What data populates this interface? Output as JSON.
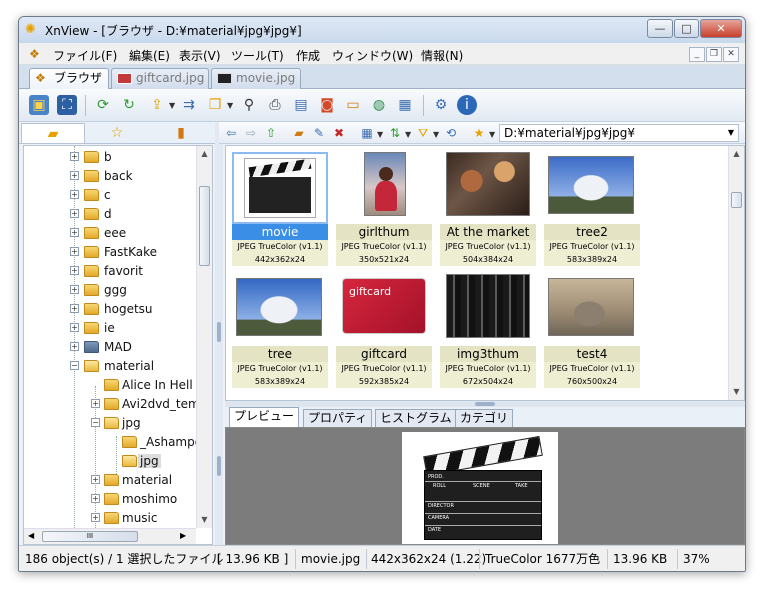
{
  "window": {
    "title": "XnView - [ブラウザ - D:¥material¥jpg¥jpg¥]",
    "controls": {
      "minimize": "—",
      "maximize": "□",
      "close": "✕"
    }
  },
  "menu": {
    "items": [
      "ファイル(F)",
      "編集(E)",
      "表示(V)",
      "ツール(T)",
      "作成",
      "ウィンドウ(W)",
      "情報(N)"
    ],
    "mdi": {
      "minimize": "_",
      "restore": "❐",
      "close": "✕"
    }
  },
  "tabs": [
    {
      "label": "ブラウザ",
      "active": true
    },
    {
      "label": "giftcard.jpg",
      "active": false
    },
    {
      "label": "movie.jpg",
      "active": false
    }
  ],
  "toolbar_icons": [
    "open-icon",
    "fullscreen-icon",
    "refresh-icon",
    "rotate-icon",
    "export-icon",
    "print-icon",
    "convert-icon",
    "find-icon",
    "printer-icon",
    "slideshow-icon",
    "camera-icon",
    "screen-icon",
    "web-icon",
    "info-icon",
    "settings-icon",
    "about-icon"
  ],
  "left_tabs": [
    "folders",
    "favorites",
    "categories"
  ],
  "tree": {
    "items": [
      {
        "label": "b",
        "level": 2,
        "expander": "+"
      },
      {
        "label": "back",
        "level": 2,
        "expander": "+"
      },
      {
        "label": "c",
        "level": 2,
        "expander": "+"
      },
      {
        "label": "d",
        "level": 2,
        "expander": "+"
      },
      {
        "label": "eee",
        "level": 2,
        "expander": "+"
      },
      {
        "label": "FastKake",
        "level": 2,
        "expander": "+"
      },
      {
        "label": "favorit",
        "level": 2,
        "expander": "+"
      },
      {
        "label": "ggg",
        "level": 2,
        "expander": "+"
      },
      {
        "label": "hogetsu",
        "level": 2,
        "expander": "+"
      },
      {
        "label": "ie",
        "level": 2,
        "expander": "+"
      },
      {
        "label": "MAD",
        "level": 2,
        "expander": "+"
      },
      {
        "label": "material",
        "level": 2,
        "expander": "−"
      },
      {
        "label": "Alice In Hell",
        "level": 3,
        "expander": ""
      },
      {
        "label": "Avi2dvd_tem",
        "level": 3,
        "expander": "+"
      },
      {
        "label": "jpg",
        "level": 3,
        "expander": "−"
      },
      {
        "label": "_Ashampo",
        "level": 4,
        "expander": ""
      },
      {
        "label": "jpg",
        "level": 4,
        "expander": "",
        "selected": true
      },
      {
        "label": "material",
        "level": 3,
        "expander": "+"
      },
      {
        "label": "moshimo",
        "level": 3,
        "expander": "+"
      },
      {
        "label": "music",
        "level": 3,
        "expander": "+"
      }
    ],
    "hscroll_grip": "III"
  },
  "navbar": {
    "path": "D:¥material¥jpg¥jpg¥"
  },
  "thumbnails": [
    {
      "name": "movie",
      "meta1": "JPEG TrueColor (v1.1)",
      "meta2": "442x362x24",
      "selected": true,
      "kind": "clapper"
    },
    {
      "name": "girlthum",
      "meta1": "JPEG TrueColor (v1.1)",
      "meta2": "350x521x24",
      "selected": false,
      "kind": "girl"
    },
    {
      "name": "At the market",
      "meta1": "JPEG TrueColor (v1.1)",
      "meta2": "504x384x24",
      "selected": false,
      "kind": "market"
    },
    {
      "name": "tree2",
      "meta1": "JPEG TrueColor (v1.1)",
      "meta2": "583x389x24",
      "selected": false,
      "kind": "tree"
    },
    {
      "name": "tree",
      "meta1": "JPEG TrueColor (v1.1)",
      "meta2": "583x389x24",
      "selected": false,
      "kind": "tree"
    },
    {
      "name": "giftcard",
      "meta1": "JPEG TrueColor (v1.1)",
      "meta2": "592x385x24",
      "selected": false,
      "kind": "giftcard"
    },
    {
      "name": "img3thum",
      "meta1": "JPEG TrueColor (v1.1)",
      "meta2": "672x504x24",
      "selected": false,
      "kind": "city"
    },
    {
      "name": "test4",
      "meta1": "JPEG TrueColor (v1.1)",
      "meta2": "760x500x24",
      "selected": false,
      "kind": "cat"
    }
  ],
  "giftcard_text": "giftcard",
  "clapper": {
    "row1": [
      "ROLL",
      "SCENE",
      "TAKE"
    ],
    "labels": [
      "PROD.",
      "DIRECTOR",
      "CAMERA",
      "DATE"
    ]
  },
  "preview_tabs": [
    "プレビュー",
    "プロパティ",
    "ヒストグラム",
    "カテゴリ"
  ],
  "status": {
    "count": "186 object(s) / 1 選択したファイル",
    "size_bracket": "[ 13.96 KB ]",
    "filename": "movie.jpg",
    "dimensions": "442x362x24 (1.22)",
    "color": "TrueColor 1677万色",
    "filesize": "13.96 KB",
    "zoom": "37%"
  },
  "colors": {
    "selection": "#3a8ee6",
    "label_bg": "#e4e4c4",
    "preview_bg": "#7c7c7c"
  }
}
